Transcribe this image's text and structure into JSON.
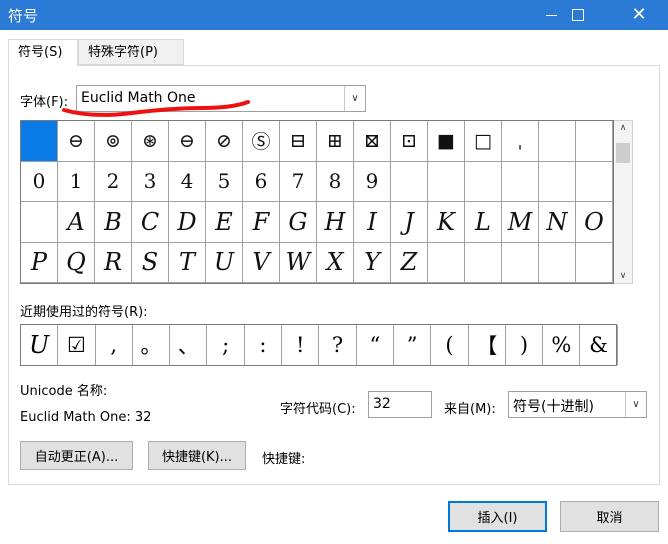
{
  "window": {
    "title": "符号"
  },
  "tabs": [
    {
      "label": "符号(S)"
    },
    {
      "label": "特殊字符(P)"
    }
  ],
  "font": {
    "label": "字体(F):",
    "value": "Euclid Math One"
  },
  "grid": {
    "rows": [
      [
        "",
        "⊖",
        "⊚",
        "⊛",
        "⊖",
        "⊘",
        "Ⓢ",
        "⊟",
        "⊞",
        "⊠",
        "⊡",
        "■",
        "□",
        "ˌ",
        "",
        ""
      ],
      [
        "0",
        "1",
        "2",
        "3",
        "4",
        "5",
        "6",
        "7",
        "8",
        "9",
        "",
        "",
        "",
        "",
        "",
        ""
      ],
      [
        "",
        "A",
        "B",
        "C",
        "D",
        "E",
        "F",
        "G",
        "H",
        "I",
        "J",
        "K",
        "L",
        "M",
        "N",
        "O"
      ],
      [
        "P",
        "Q",
        "R",
        "S",
        "T",
        "U",
        "V",
        "W",
        "X",
        "Y",
        "Z",
        "",
        "",
        "",
        "",
        ""
      ]
    ]
  },
  "recent": {
    "label": "近期使用过的符号(R):",
    "items": [
      "U",
      "☑",
      ",",
      "。",
      "、",
      ";",
      ":",
      "!",
      "?",
      "“",
      "”",
      "(",
      "【",
      ")",
      "%",
      "&"
    ]
  },
  "unicode": {
    "name_label": "Unicode 名称:",
    "name_value": "Euclid Math One: 32"
  },
  "char_code": {
    "label": "字符代码(C):",
    "value": "32"
  },
  "from": {
    "label": "来自(M):",
    "value": "符号(十进制)"
  },
  "buttons": {
    "autocorrect": "自动更正(A)...",
    "shortcut_key": "快捷键(K)...",
    "shortcut_label": "快捷键:",
    "insert": "插入(I)",
    "cancel": "取消"
  }
}
